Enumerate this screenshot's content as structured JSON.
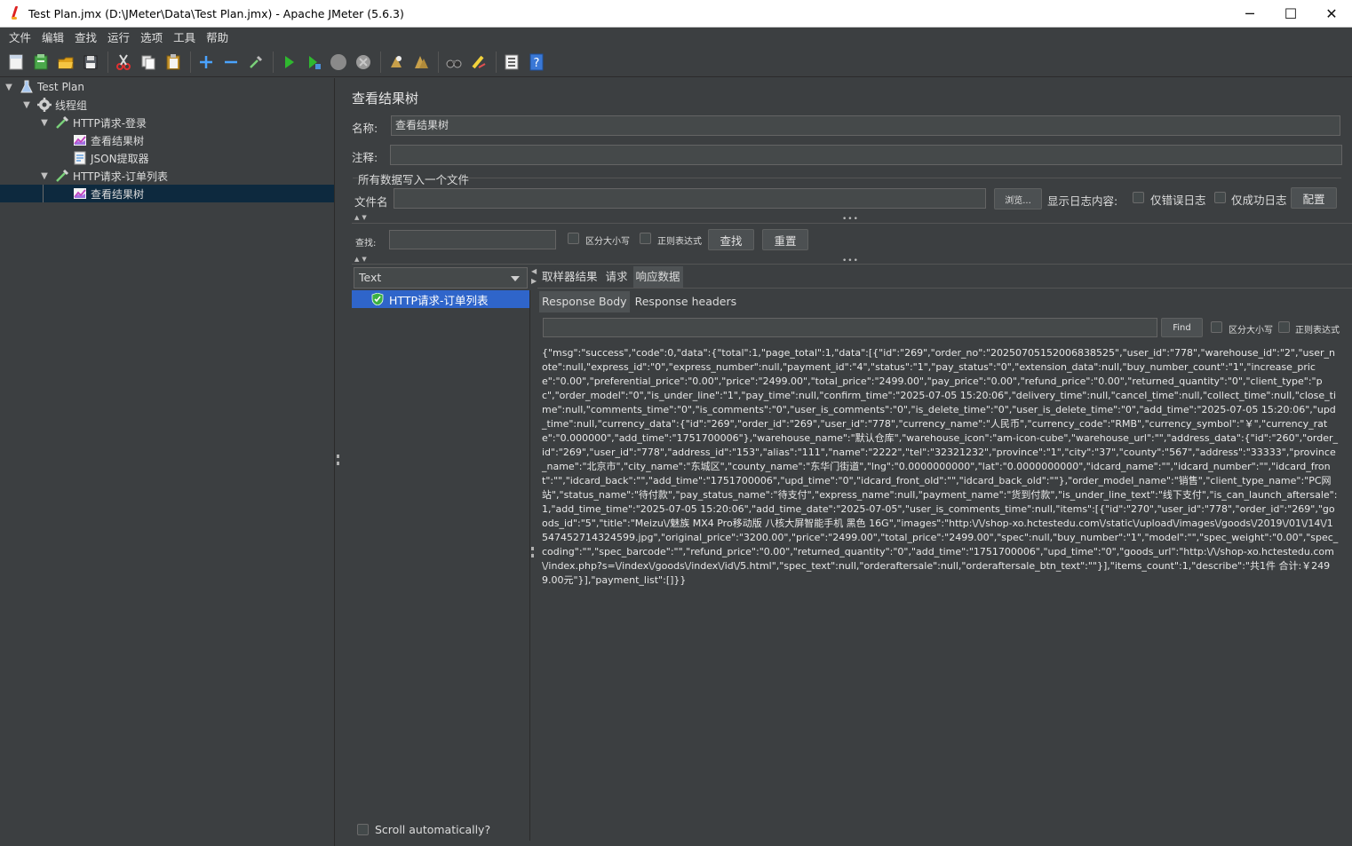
{
  "window": {
    "title": "Test Plan.jmx (D:\\JMeter\\Data\\Test Plan.jmx) - Apache JMeter (5.6.3)",
    "minimize": "─",
    "maximize": "☐",
    "close": "✕"
  },
  "menu": [
    "文件",
    "编辑",
    "查找",
    "运行",
    "选项",
    "工具",
    "帮助"
  ],
  "toolbar": {
    "icons": [
      "new-icon",
      "templates-icon",
      "open-icon",
      "save-icon",
      "cut-icon",
      "copy-icon",
      "paste-icon",
      "expand-icon",
      "collapse-icon",
      "toggle-icon",
      "start-icon",
      "start-no-pause-icon",
      "stop-icon",
      "shutdown-icon",
      "clear-icon",
      "clear-all-icon",
      "search-icon",
      "reset-search-icon",
      "function-helper-icon",
      "help-icon"
    ]
  },
  "tree": {
    "nodes": [
      {
        "label": "Test Plan",
        "depth": 0,
        "expanded": true,
        "icon": "test-plan-icon"
      },
      {
        "label": "线程组",
        "depth": 1,
        "expanded": true,
        "icon": "thread-group-gear-icon"
      },
      {
        "label": "HTTP请求-登录",
        "depth": 2,
        "expanded": true,
        "icon": "http-sampler-pipette-icon"
      },
      {
        "label": "查看结果树",
        "depth": 3,
        "icon": "view-results-tree-icon"
      },
      {
        "label": "JSON提取器",
        "depth": 3,
        "icon": "json-extractor-icon"
      },
      {
        "label": "HTTP请求-订单列表",
        "depth": 2,
        "expanded": true,
        "icon": "http-sampler-pipette-icon"
      },
      {
        "label": "查看结果树",
        "depth": 3,
        "icon": "view-results-tree-icon",
        "selected": true
      }
    ]
  },
  "panel": {
    "title": "查看结果树",
    "name_label": "名称:",
    "name_value": "查看结果树",
    "comment_label": "注释:",
    "comment_value": "",
    "write_all_label": "所有数据写入一个文件",
    "filename_label": "文件名",
    "filename_value": "",
    "browse_label": "浏览...",
    "log_contents_label": "显示日志内容:",
    "errors_only_label": "仅错误日志",
    "success_only_label": "仅成功日志",
    "configure_label": "配置",
    "search_label": "查找:",
    "search_value": "",
    "case_sensitive_label": "区分大小写",
    "regex_label": "正则表达式",
    "find_button": "查找",
    "reset_button": "重置"
  },
  "results": {
    "renderer": "Text",
    "samples": [
      {
        "label": "HTTP请求-订单列表",
        "status": "success"
      }
    ],
    "tabs": [
      "取样器结果",
      "请求",
      "响应数据"
    ],
    "active_tab": "响应数据",
    "subtabs": [
      "Response Body",
      "Response headers"
    ],
    "active_subtab": "Response Body",
    "find_value": "",
    "find_button": "Find",
    "case_sensitive_label": "区分大小写",
    "regex_label": "正则表达式",
    "response_body": "{\"msg\":\"success\",\"code\":0,\"data\":{\"total\":1,\"page_total\":1,\"data\":[{\"id\":\"269\",\"order_no\":\"20250705152006838525\",\"user_id\":\"778\",\"warehouse_id\":\"2\",\"user_note\":null,\"express_id\":\"0\",\"express_number\":null,\"payment_id\":\"4\",\"status\":\"1\",\"pay_status\":\"0\",\"extension_data\":null,\"buy_number_count\":\"1\",\"increase_price\":\"0.00\",\"preferential_price\":\"0.00\",\"price\":\"2499.00\",\"total_price\":\"2499.00\",\"pay_price\":\"0.00\",\"refund_price\":\"0.00\",\"returned_quantity\":\"0\",\"client_type\":\"pc\",\"order_model\":\"0\",\"is_under_line\":\"1\",\"pay_time\":null,\"confirm_time\":\"2025-07-05 15:20:06\",\"delivery_time\":null,\"cancel_time\":null,\"collect_time\":null,\"close_time\":null,\"comments_time\":\"0\",\"is_comments\":\"0\",\"user_is_comments\":\"0\",\"is_delete_time\":\"0\",\"user_is_delete_time\":\"0\",\"add_time\":\"2025-07-05 15:20:06\",\"upd_time\":null,\"currency_data\":{\"id\":\"269\",\"order_id\":\"269\",\"user_id\":\"778\",\"currency_name\":\"人民币\",\"currency_code\":\"RMB\",\"currency_symbol\":\"￥\",\"currency_rate\":\"0.000000\",\"add_time\":\"1751700006\"},\"warehouse_name\":\"默认仓库\",\"warehouse_icon\":\"am-icon-cube\",\"warehouse_url\":\"\",\"address_data\":{\"id\":\"260\",\"order_id\":\"269\",\"user_id\":\"778\",\"address_id\":\"153\",\"alias\":\"111\",\"name\":\"2222\",\"tel\":\"32321232\",\"province\":\"1\",\"city\":\"37\",\"county\":\"567\",\"address\":\"33333\",\"province_name\":\"北京市\",\"city_name\":\"东城区\",\"county_name\":\"东华门街道\",\"lng\":\"0.0000000000\",\"lat\":\"0.0000000000\",\"idcard_name\":\"\",\"idcard_number\":\"\",\"idcard_front\":\"\",\"idcard_back\":\"\",\"add_time\":\"1751700006\",\"upd_time\":\"0\",\"idcard_front_old\":\"\",\"idcard_back_old\":\"\"},\"order_model_name\":\"销售\",\"client_type_name\":\"PC网站\",\"status_name\":\"待付款\",\"pay_status_name\":\"待支付\",\"express_name\":null,\"payment_name\":\"货到付款\",\"is_under_line_text\":\"线下支付\",\"is_can_launch_aftersale\":1,\"add_time_time\":\"2025-07-05 15:20:06\",\"add_time_date\":\"2025-07-05\",\"user_is_comments_time\":null,\"items\":[{\"id\":\"270\",\"user_id\":\"778\",\"order_id\":\"269\",\"goods_id\":\"5\",\"title\":\"Meizu\\/魅族 MX4 Pro移动版 八核大屏智能手机 黑色 16G\",\"images\":\"http:\\/\\/shop-xo.hctestedu.com\\/static\\/upload\\/images\\/goods\\/2019\\/01\\/14\\/1547452714324599.jpg\",\"original_price\":\"3200.00\",\"price\":\"2499.00\",\"total_price\":\"2499.00\",\"spec\":null,\"buy_number\":\"1\",\"model\":\"\",\"spec_weight\":\"0.00\",\"spec_coding\":\"\",\"spec_barcode\":\"\",\"refund_price\":\"0.00\",\"returned_quantity\":\"0\",\"add_time\":\"1751700006\",\"upd_time\":\"0\",\"goods_url\":\"http:\\/\\/shop-xo.hctestedu.com\\/index.php?s=\\/index\\/goods\\/index\\/id\\/5.html\",\"spec_text\":null,\"orderaftersale\":null,\"orderaftersale_btn_text\":\"\"}],\"items_count\":1,\"describe\":\"共1件 合计:￥2499.00元\"}],\"payment_list\":[]}}",
    "scroll_auto_label": "Scroll automatically?"
  },
  "colors": {
    "background": "#3c3f41",
    "field": "#45494a",
    "tree_selection": "#0d293e",
    "list_selection": "#2f65ca",
    "success_green": "#3cb043"
  }
}
